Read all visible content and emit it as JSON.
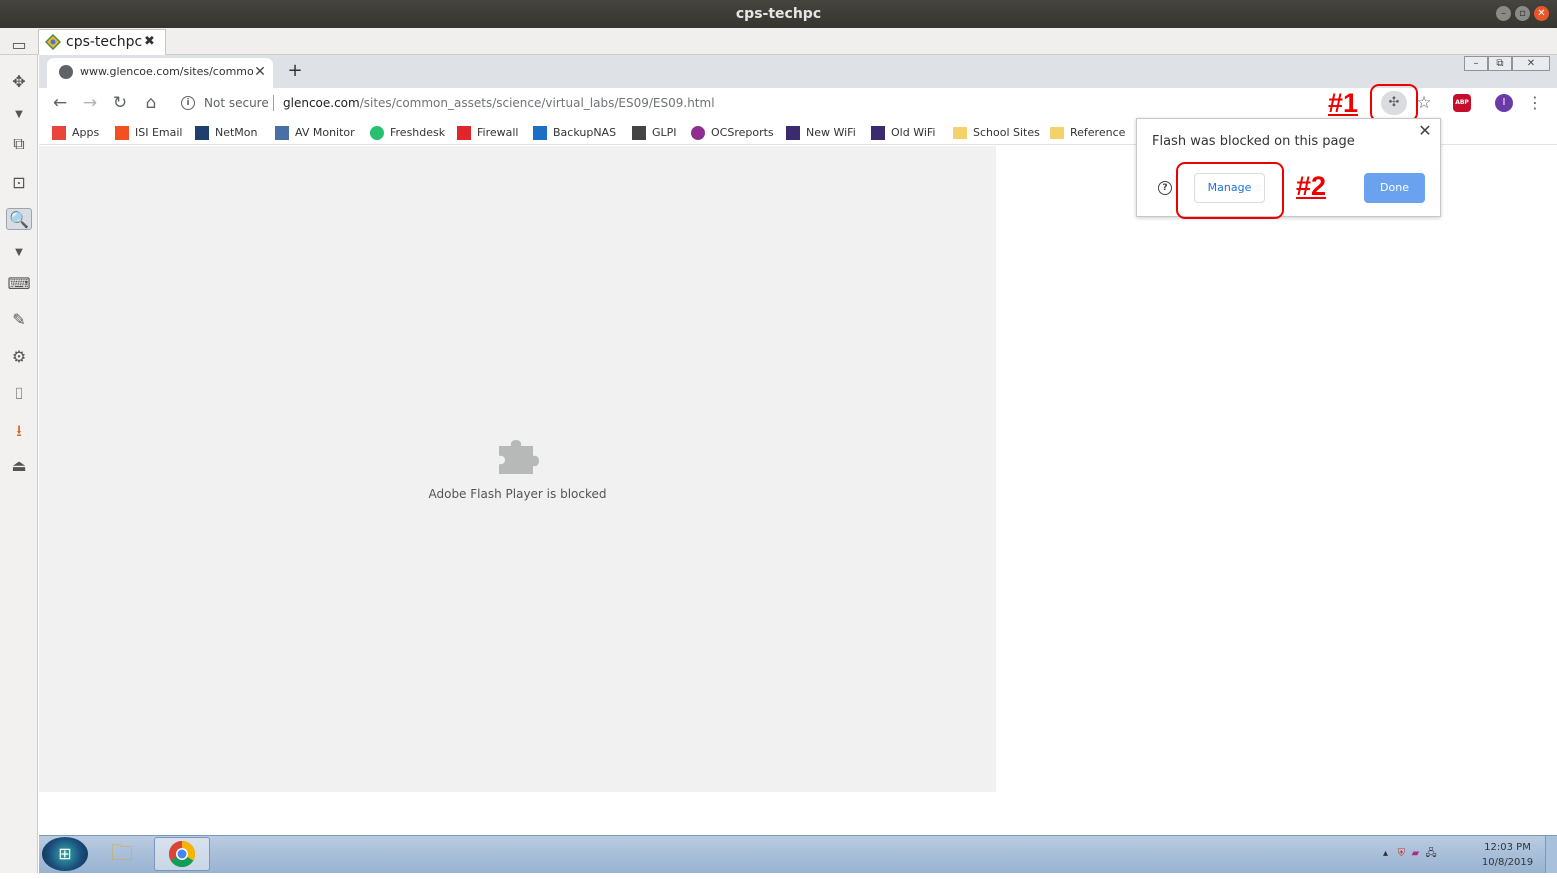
{
  "os_window": {
    "title": "cps-techpc",
    "tab_label": "cps-techpc"
  },
  "chrome": {
    "tab_title": "www.glencoe.com/sites/commo",
    "new_tab_symbol": "+",
    "omnibox": {
      "security_label": "Not secure",
      "url_host": "glencoe.com",
      "url_path": "/sites/common_assets/science/virtual_labs/ES09/ES09.html"
    },
    "profile_initial": "I",
    "abp_label": "ABP",
    "bookmarks": [
      {
        "label": "Apps",
        "icon": "apps-grid-icon",
        "color": "#e8453c"
      },
      {
        "label": "ISI Email",
        "icon": "microsoft-icon",
        "color": "#f25022"
      },
      {
        "label": "NetMon",
        "icon": "grid-icon",
        "color": "#1f3f6e"
      },
      {
        "label": "AV Monitor",
        "icon": "dots-grid-icon",
        "color": "#4a6fa5"
      },
      {
        "label": "Freshdesk",
        "icon": "freshdesk-icon",
        "color": "#25c16f"
      },
      {
        "label": "Firewall",
        "icon": "fortinet-icon",
        "color": "#e0252b"
      },
      {
        "label": "BackupNAS",
        "icon": "dsm-icon",
        "color": "#1d6fc4"
      },
      {
        "label": "GLPI",
        "icon": "glpi-icon",
        "color": "#444444"
      },
      {
        "label": "OCSreports",
        "icon": "ocs-icon",
        "color": "#8e2e8e"
      },
      {
        "label": "New WiFi",
        "icon": "e-logo-icon",
        "color": "#3b2a6e"
      },
      {
        "label": "Old WiFi",
        "icon": "e-logo-icon",
        "color": "#3b2a6e"
      },
      {
        "label": "School Sites",
        "icon": "folder-icon",
        "color": "#f4d26b"
      },
      {
        "label": "Reference",
        "icon": "folder-icon",
        "color": "#f4d26b"
      }
    ]
  },
  "annotations": {
    "label1": "#1",
    "label2": "#2"
  },
  "content": {
    "plugin_blocked_text": "Adobe Flash Player is blocked"
  },
  "flash_popup": {
    "title": "Flash was blocked on this page",
    "manage_label": "Manage",
    "done_label": "Done"
  },
  "taskbar": {
    "clock_time": "12:03 PM",
    "clock_date": "10/8/2019"
  },
  "colors": {
    "annotation": "#e00000",
    "done_button": "#6aa2f0",
    "manage_text": "#1a73e8"
  }
}
